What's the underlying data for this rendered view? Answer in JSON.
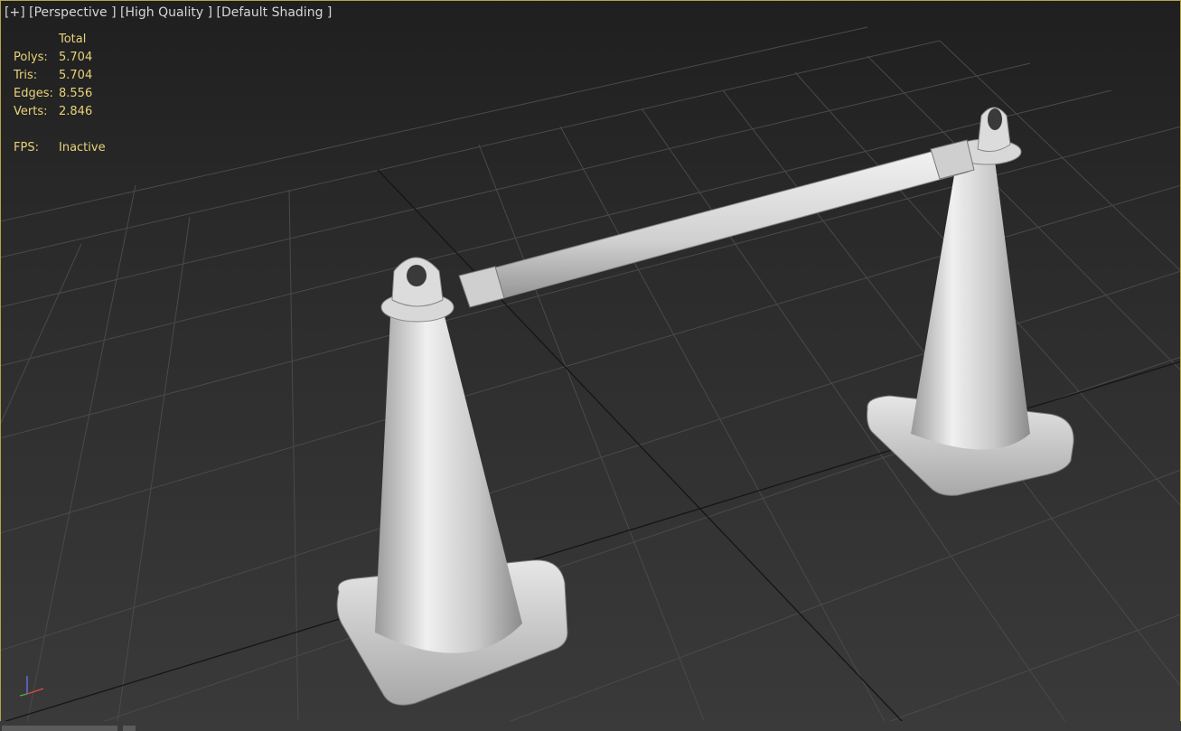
{
  "viewport": {
    "labels": [
      "[+]",
      "[Perspective ]",
      "[High Quality ]",
      "[Default Shading ]"
    ]
  },
  "stats": {
    "header": "Total",
    "polys_label": "Polys:",
    "polys_value": "5.704",
    "tris_label": "Tris:",
    "tris_value": "5.704",
    "edges_label": "Edges:",
    "edges_value": "8.556",
    "verts_label": "Verts:",
    "verts_value": "2.846",
    "fps_label": "FPS:",
    "fps_value": "Inactive"
  },
  "colors": {
    "stats_text": "#e8d27a",
    "viewport_border": "#b8a24a",
    "grid_line": "#4a4a4a",
    "grid_major": "#111111",
    "model": "#dcdcdc"
  },
  "gizmo": {
    "axes": [
      "z",
      "y",
      "x"
    ]
  }
}
